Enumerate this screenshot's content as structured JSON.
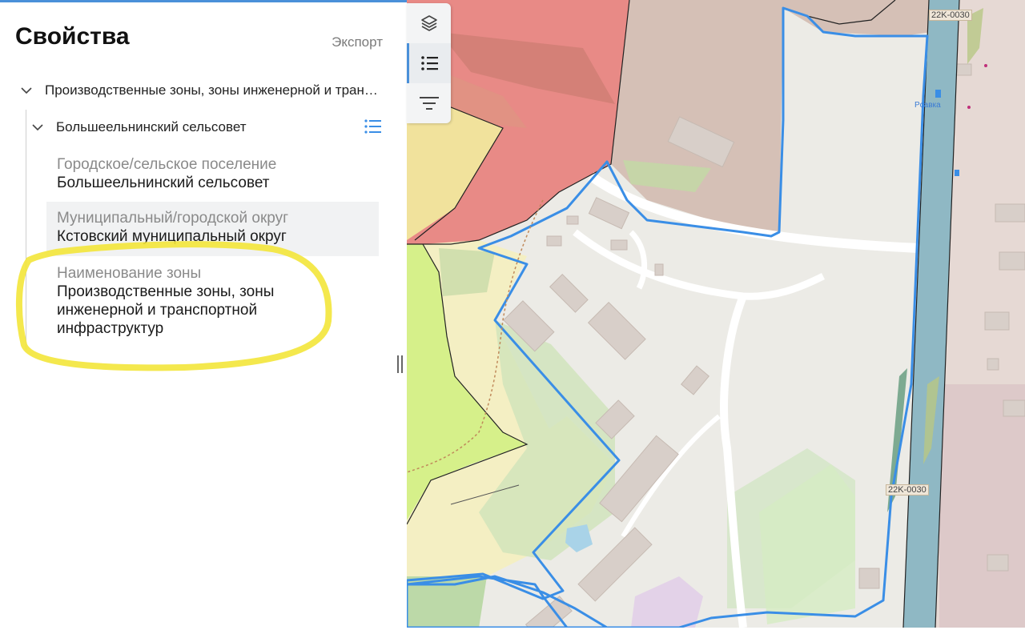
{
  "panel": {
    "title": "Свойства",
    "export_label": "Экспорт",
    "tree": {
      "level1_label": "Производственные зоны, зоны инженерной и транс…",
      "level2_label": "Большеельнинский сельсовет"
    },
    "properties": [
      {
        "key": "Городское/сельское поселение",
        "value": "Большеельнинский сельсовет"
      },
      {
        "key": "Муниципальный/городской округ",
        "value": "Кстовский муниципальный округ"
      },
      {
        "key": "Наименование зоны",
        "value_lines": [
          "Производственные зоны, зоны",
          "инженерной и транспортной",
          "инфраструктур"
        ]
      }
    ]
  },
  "toolbar": {
    "buttons": [
      {
        "name": "layers-button",
        "icon": "layers-icon",
        "active": false
      },
      {
        "name": "list-button",
        "icon": "list-icon",
        "active": true
      },
      {
        "name": "filter-button",
        "icon": "filter-icon",
        "active": false
      }
    ]
  },
  "map": {
    "road_label": "22K-0030",
    "road_label_bottom": "22K-0030",
    "place_label": "Рсавка",
    "colors": {
      "selection_outline": "#3a8ee6",
      "industrial_zone": "#e88a86",
      "residential_zone": "#d9c6bc",
      "agricultural_zone": "#d6f08a",
      "yellow_zone": "#f3e7a0",
      "road_strip": "#8fb8c4",
      "highlight_marker": "#f5e83a"
    }
  }
}
